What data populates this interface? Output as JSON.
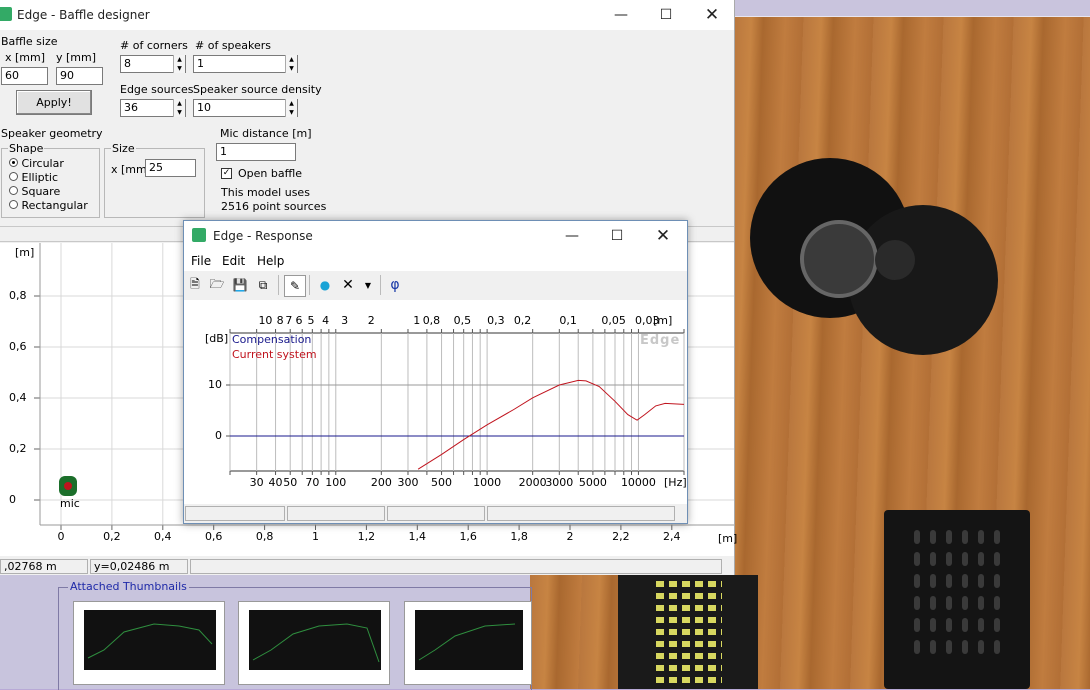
{
  "baffle_window": {
    "title": "Edge - Baffle designer",
    "baffle_size": {
      "group_label": "Baffle size",
      "x_label": "x [mm]",
      "x_value": "60",
      "y_label": "y [mm]",
      "y_value": "90",
      "apply_label": "Apply!"
    },
    "corners": {
      "label": "# of corners",
      "value": "8"
    },
    "speakers": {
      "label": "# of speakers",
      "value": "1"
    },
    "edge_sources": {
      "label": "Edge sources",
      "value": "36"
    },
    "source_density": {
      "label": "Speaker source density",
      "value": "10"
    },
    "speaker_geometry": {
      "group_label": "Speaker geometry",
      "shape_label": "Shape",
      "shapes": [
        "Circular",
        "Elliptic",
        "Square",
        "Rectangular"
      ],
      "selected_shape": "Circular",
      "size_label": "Size",
      "size_x_label": "x [mm]",
      "size_x_value": "25"
    },
    "mic": {
      "label": "Mic distance [m]",
      "value": "1",
      "open_baffle_label": "Open baffle",
      "open_baffle_checked": true,
      "model_line1": "This model uses",
      "model_line2": "2516 point sources"
    },
    "plot": {
      "y_unit": "[m]",
      "x_unit": "[m]",
      "y_ticks": [
        "0,8",
        "0,6",
        "0,4",
        "0,2",
        "0"
      ],
      "x_ticks": [
        "0",
        "0,2",
        "0,4",
        "0,6",
        "0,8",
        "1",
        "1,2",
        "1,4",
        "1,6",
        "1,8",
        "2",
        "2,2",
        "2,4"
      ],
      "mic_label": "mic"
    },
    "status": {
      "x_readout": ",02768 m",
      "y_readout": "y=0,02486 m"
    }
  },
  "response_window": {
    "title": "Edge - Response",
    "menu": [
      "File",
      "Edit",
      "Help"
    ],
    "toolbar_icons": [
      "new-file-icon",
      "open-folder-icon",
      "save-icon",
      "copy-icon",
      "pen-icon",
      "person-icon",
      "delete-icon",
      "dropdown-arrow-icon",
      "phase-icon"
    ],
    "phase_symbol": "φ",
    "graph": {
      "top_axis_labels": [
        "10",
        "8",
        "7",
        "6",
        "5",
        "4",
        "3",
        "2",
        "1",
        "0,8",
        "0,5",
        "0,3",
        "0,2",
        "0,1",
        "0,05",
        "0,03"
      ],
      "top_axis_unit": "[m]",
      "bottom_axis_labels": [
        "30",
        "40",
        "50",
        "70",
        "100",
        "200",
        "300",
        "500",
        "1000",
        "2000",
        "3000",
        "5000",
        "10000"
      ],
      "bottom_axis_unit": "[Hz]",
      "y_unit": "[dB]",
      "y_ticks": [
        "10",
        "0"
      ],
      "legend_compensation": "Compensation",
      "legend_current": "Current system",
      "watermark": "Edge",
      "compensation_color": "#1a1a8c",
      "current_color": "#c0141e"
    }
  },
  "thumbnails": {
    "title": "Attached Thumbnails"
  }
}
